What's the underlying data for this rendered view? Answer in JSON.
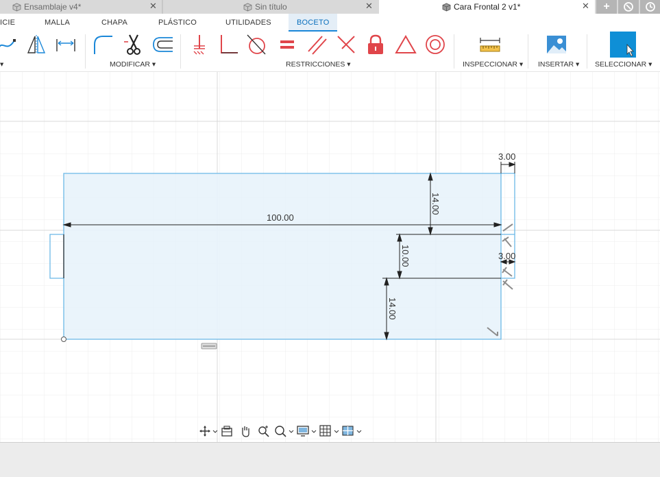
{
  "doc_tabs": [
    {
      "label": "Ensamblaje v4*",
      "active": false
    },
    {
      "label": "Sin título",
      "active": false
    },
    {
      "label": "Cara Frontal 2 v1*",
      "active": true
    }
  ],
  "close_glyph": "✕",
  "tabbar_buttons": {
    "new_tab": "+"
  },
  "workspace_tabs": [
    "ICIE",
    "MALLA",
    "CHAPA",
    "PLÁSTICO",
    "UTILIDADES",
    "BOCETO"
  ],
  "active_workspace": "BOCETO",
  "toolbar_groups": {
    "create_caret": "▾",
    "modificar": "MODIFICAR ▾",
    "restricciones": "RESTRICCIONES ▾",
    "inspeccionar": "INSPECCIONAR ▾",
    "insertar": "INSERTAR ▾",
    "seleccionar": "SELECCIONAR ▾"
  },
  "dimensions": {
    "width_total": "100.00",
    "top_offset": "3.00",
    "upper_height": "14.00",
    "mid_height": "10.00",
    "side_offset": "3.00",
    "lower_height": "14.00"
  },
  "colors": {
    "sketch_line": "#6bb8e6",
    "profile_fill": "#e8f3fb",
    "accent": "#1a87d8",
    "select_button": "#0f8fd6",
    "constraint_red": "#e0454a"
  }
}
